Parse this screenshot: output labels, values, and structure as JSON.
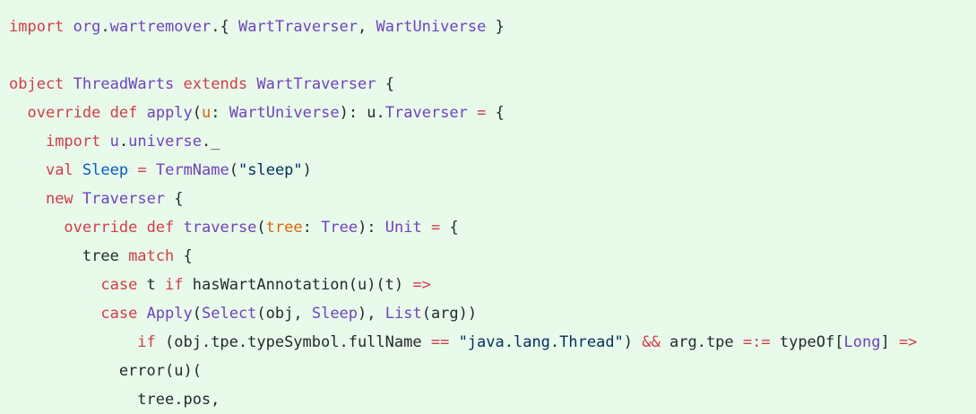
{
  "theme": {
    "background": "#e8fbea",
    "keyword": "#d73a49",
    "type": "#6f42c1",
    "name": "#005cc5",
    "param": "#e36209",
    "string": "#032f62",
    "plain": "#24292e"
  },
  "code_lines": [
    [
      {
        "t": "kw",
        "v": "import"
      },
      {
        "t": "plain",
        "v": " "
      },
      {
        "t": "type",
        "v": "org"
      },
      {
        "t": "plain",
        "v": "."
      },
      {
        "t": "type",
        "v": "wartremover"
      },
      {
        "t": "plain",
        "v": ".{ "
      },
      {
        "t": "type",
        "v": "WartTraverser"
      },
      {
        "t": "plain",
        "v": ", "
      },
      {
        "t": "type",
        "v": "WartUniverse"
      },
      {
        "t": "plain",
        "v": " }"
      }
    ],
    [],
    [
      {
        "t": "kw",
        "v": "object"
      },
      {
        "t": "plain",
        "v": " "
      },
      {
        "t": "type",
        "v": "ThreadWarts"
      },
      {
        "t": "plain",
        "v": " "
      },
      {
        "t": "kw",
        "v": "extends"
      },
      {
        "t": "plain",
        "v": " "
      },
      {
        "t": "type",
        "v": "WartTraverser"
      },
      {
        "t": "plain",
        "v": " {"
      }
    ],
    [
      {
        "t": "plain",
        "v": "  "
      },
      {
        "t": "kw",
        "v": "override"
      },
      {
        "t": "plain",
        "v": " "
      },
      {
        "t": "kw",
        "v": "def"
      },
      {
        "t": "plain",
        "v": " "
      },
      {
        "t": "type",
        "v": "apply"
      },
      {
        "t": "plain",
        "v": "("
      },
      {
        "t": "param",
        "v": "u"
      },
      {
        "t": "plain",
        "v": ": "
      },
      {
        "t": "type",
        "v": "WartUniverse"
      },
      {
        "t": "plain",
        "v": "): u."
      },
      {
        "t": "type",
        "v": "Traverser"
      },
      {
        "t": "plain",
        "v": " "
      },
      {
        "t": "op",
        "v": "="
      },
      {
        "t": "plain",
        "v": " {"
      }
    ],
    [
      {
        "t": "plain",
        "v": "    "
      },
      {
        "t": "kw",
        "v": "import"
      },
      {
        "t": "plain",
        "v": " "
      },
      {
        "t": "type",
        "v": "u"
      },
      {
        "t": "plain",
        "v": "."
      },
      {
        "t": "type",
        "v": "universe"
      },
      {
        "t": "plain",
        "v": "._"
      }
    ],
    [
      {
        "t": "plain",
        "v": "    "
      },
      {
        "t": "kw",
        "v": "val"
      },
      {
        "t": "plain",
        "v": " "
      },
      {
        "t": "name",
        "v": "Sleep"
      },
      {
        "t": "plain",
        "v": " "
      },
      {
        "t": "op",
        "v": "="
      },
      {
        "t": "plain",
        "v": " "
      },
      {
        "t": "type",
        "v": "TermName"
      },
      {
        "t": "plain",
        "v": "("
      },
      {
        "t": "str",
        "v": "\"sleep\""
      },
      {
        "t": "plain",
        "v": ")"
      }
    ],
    [
      {
        "t": "plain",
        "v": "    "
      },
      {
        "t": "kw",
        "v": "new"
      },
      {
        "t": "plain",
        "v": " "
      },
      {
        "t": "type",
        "v": "Traverser"
      },
      {
        "t": "plain",
        "v": " {"
      }
    ],
    [
      {
        "t": "plain",
        "v": "      "
      },
      {
        "t": "kw",
        "v": "override"
      },
      {
        "t": "plain",
        "v": " "
      },
      {
        "t": "kw",
        "v": "def"
      },
      {
        "t": "plain",
        "v": " "
      },
      {
        "t": "type",
        "v": "traverse"
      },
      {
        "t": "plain",
        "v": "("
      },
      {
        "t": "param",
        "v": "tree"
      },
      {
        "t": "plain",
        "v": ": "
      },
      {
        "t": "type",
        "v": "Tree"
      },
      {
        "t": "plain",
        "v": "): "
      },
      {
        "t": "type",
        "v": "Unit"
      },
      {
        "t": "plain",
        "v": " "
      },
      {
        "t": "op",
        "v": "="
      },
      {
        "t": "plain",
        "v": " {"
      }
    ],
    [
      {
        "t": "plain",
        "v": "        tree "
      },
      {
        "t": "kw",
        "v": "match"
      },
      {
        "t": "plain",
        "v": " {"
      }
    ],
    [
      {
        "t": "plain",
        "v": "          "
      },
      {
        "t": "kw",
        "v": "case"
      },
      {
        "t": "plain",
        "v": " t "
      },
      {
        "t": "kw",
        "v": "if"
      },
      {
        "t": "plain",
        "v": " hasWartAnnotation(u)(t) "
      },
      {
        "t": "op",
        "v": "=>"
      }
    ],
    [
      {
        "t": "plain",
        "v": "          "
      },
      {
        "t": "kw",
        "v": "case"
      },
      {
        "t": "plain",
        "v": " "
      },
      {
        "t": "type",
        "v": "Apply"
      },
      {
        "t": "plain",
        "v": "("
      },
      {
        "t": "type",
        "v": "Select"
      },
      {
        "t": "plain",
        "v": "(obj, "
      },
      {
        "t": "type",
        "v": "Sleep"
      },
      {
        "t": "plain",
        "v": "), "
      },
      {
        "t": "type",
        "v": "List"
      },
      {
        "t": "plain",
        "v": "(arg))"
      }
    ],
    [
      {
        "t": "plain",
        "v": "              "
      },
      {
        "t": "kw",
        "v": "if"
      },
      {
        "t": "plain",
        "v": " (obj.tpe.typeSymbol.fullName "
      },
      {
        "t": "op",
        "v": "=="
      },
      {
        "t": "plain",
        "v": " "
      },
      {
        "t": "str",
        "v": "\"java.lang.Thread\""
      },
      {
        "t": "plain",
        "v": ") "
      },
      {
        "t": "op",
        "v": "&&"
      },
      {
        "t": "plain",
        "v": " arg.tpe "
      },
      {
        "t": "op",
        "v": "=:="
      },
      {
        "t": "plain",
        "v": " typeOf["
      },
      {
        "t": "type",
        "v": "Long"
      },
      {
        "t": "plain",
        "v": "] "
      },
      {
        "t": "op",
        "v": "=>"
      }
    ],
    [
      {
        "t": "plain",
        "v": "            error(u)("
      }
    ],
    [
      {
        "t": "plain",
        "v": "              tree.pos,"
      }
    ]
  ]
}
